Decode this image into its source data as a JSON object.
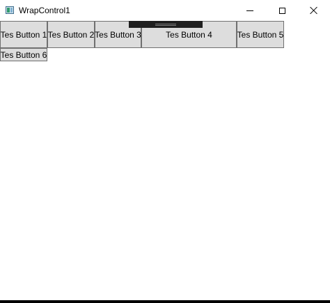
{
  "window": {
    "title": "WrapControl1",
    "icon": "wpf-app-icon",
    "caption_buttons": [
      "minimize-icon",
      "maximize-icon",
      "close-icon"
    ]
  },
  "buttons": [
    {
      "label": "Tes Button 1"
    },
    {
      "label": "Tes Button 2"
    },
    {
      "label": "Tes Button 3"
    },
    {
      "label": "Tes Button 4"
    },
    {
      "label": "Tes Button 5"
    },
    {
      "label": "Tes Button 6"
    }
  ],
  "colors": {
    "button_bg": "#dddddd",
    "button_border": "#707070",
    "handle_bg": "#1f1f1f",
    "window_bg": "#ffffff"
  }
}
